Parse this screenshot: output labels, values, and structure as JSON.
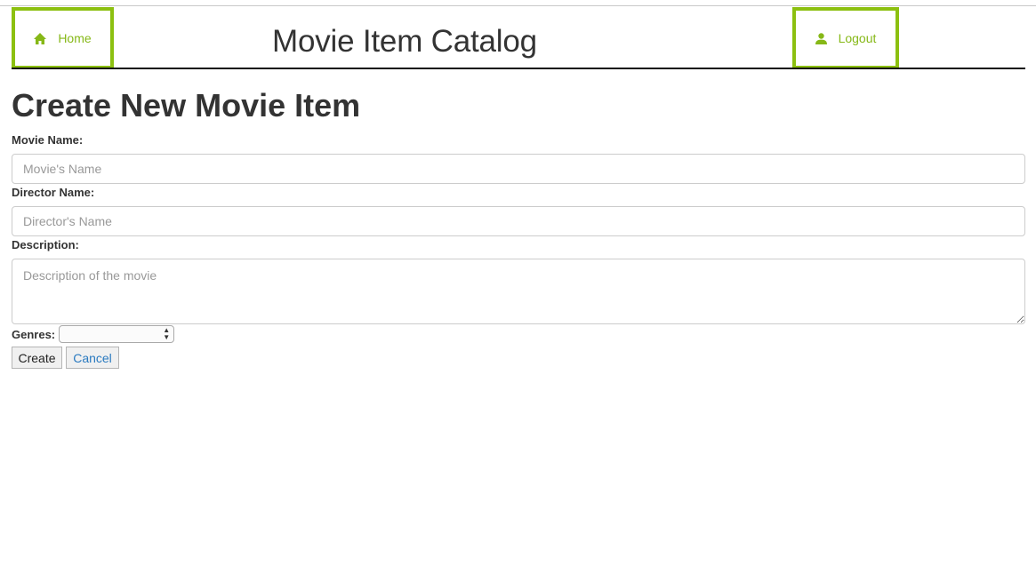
{
  "nav": {
    "home_label": "Home",
    "home_icon": "home-icon",
    "logout_label": "Logout",
    "logout_icon": "user-icon",
    "accent": "#8cc010"
  },
  "header": {
    "site_title": "Movie Item Catalog"
  },
  "page": {
    "title": "Create New Movie Item"
  },
  "form": {
    "movie_name_label": "Movie Name:",
    "movie_name_placeholder": "Movie's Name",
    "movie_name_value": "",
    "director_label": "Director Name:",
    "director_placeholder": "Director's Name",
    "director_value": "",
    "description_label": "Description:",
    "description_placeholder": "Description of the movie",
    "description_value": "",
    "genres_label": "Genres:",
    "genres_selected": "",
    "create_label": "Create",
    "cancel_label": "Cancel"
  }
}
